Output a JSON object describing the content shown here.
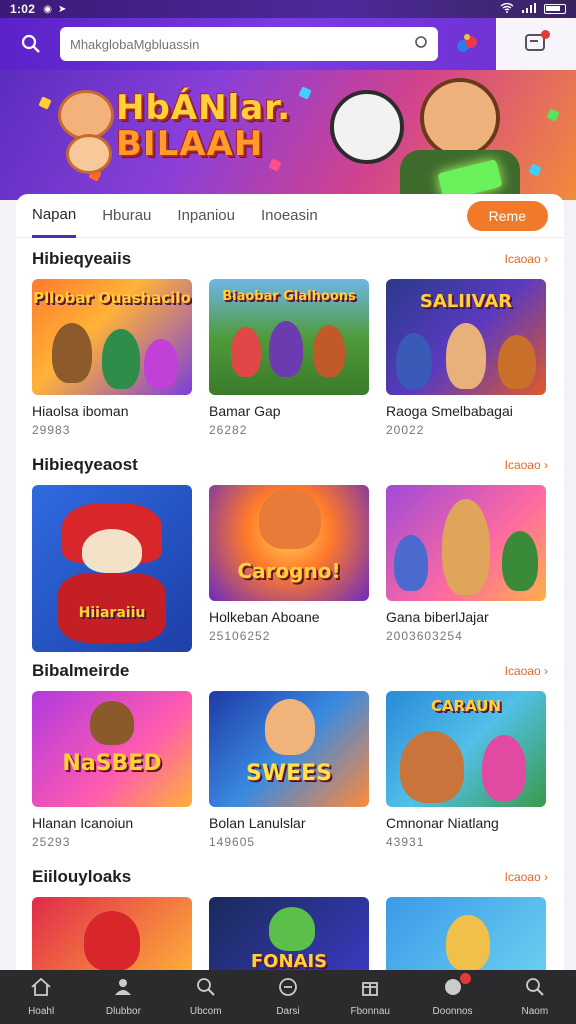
{
  "status_bar": {
    "time": "1:02",
    "icons_left": [
      "signal-icon",
      "location-icon"
    ],
    "icons_right": [
      "wifi-icon",
      "cell-signal-icon",
      "battery-icon"
    ]
  },
  "header": {
    "search_placeholder": "MhakglobaMgbluassin",
    "icons": [
      "search-icon",
      "camera-icon",
      "gamepad-icon",
      "notification-icon"
    ]
  },
  "banner": {
    "title_line1": "HbÁNlar.",
    "title_line2": "BILAAH"
  },
  "tabs": {
    "items": [
      "Napan",
      "Hburau",
      "Inpaniou",
      "Inoeasin"
    ],
    "active": 0,
    "cta": "Reme"
  },
  "sections": [
    {
      "title": "Hibieqyeaiis",
      "see_all": "Icaoao",
      "games": [
        {
          "name": "Hiaolsa iboman",
          "count": "29983",
          "label": "Pllobar Ouashacilo"
        },
        {
          "name": "Bamar Gap",
          "count": "26282",
          "label": "Biaobar Glalhoons"
        },
        {
          "name": "Raoga Smelbabagai",
          "count": "20022",
          "label": "SALIIVAR"
        }
      ]
    },
    {
      "title": "Hibieqyeaost",
      "see_all": "Icaoao",
      "games": [
        {
          "name": "",
          "count": "",
          "label": "Hiiaraiiu"
        },
        {
          "name": "Holkeban Aboane",
          "count": "25106252",
          "label": "Carogno!"
        },
        {
          "name": "Gana biberlJajar",
          "count": "2003603254",
          "label": ""
        }
      ]
    },
    {
      "title": "Bibalmeirde",
      "see_all": "Icaoao",
      "games": [
        {
          "name": "Hlanan Icanoiun",
          "count": "25293",
          "label": "NaSBED"
        },
        {
          "name": "Bolan Lanulslar",
          "count": "149605",
          "label": "SWEES"
        },
        {
          "name": "Cmnonar Niatlang",
          "count": "43931",
          "label": "CARAUN"
        }
      ]
    },
    {
      "title": "Eiilouyloaks",
      "see_all": "Icaoao",
      "games": [
        {
          "name": "",
          "count": "",
          "label": ""
        },
        {
          "name": "",
          "count": "",
          "label": "FONAIS"
        },
        {
          "name": "",
          "count": "",
          "label": ""
        }
      ]
    }
  ],
  "bottom_nav": [
    {
      "label": "Hoahl",
      "icon": "home-icon"
    },
    {
      "label": "Dlubbor",
      "icon": "users-icon"
    },
    {
      "label": "Ubcom",
      "icon": "search-icon"
    },
    {
      "label": "Darsi",
      "icon": "gamepad-icon"
    },
    {
      "label": "Fbonnau",
      "icon": "gift-icon"
    },
    {
      "label": "Doonnos",
      "icon": "notification-icon"
    },
    {
      "label": "Naom",
      "icon": "profile-icon"
    }
  ],
  "colors": {
    "brand": "#5a22c8",
    "accent": "#f07a2a",
    "nav_bg": "#2b2b2e",
    "tab_active": "#4b2db7"
  }
}
